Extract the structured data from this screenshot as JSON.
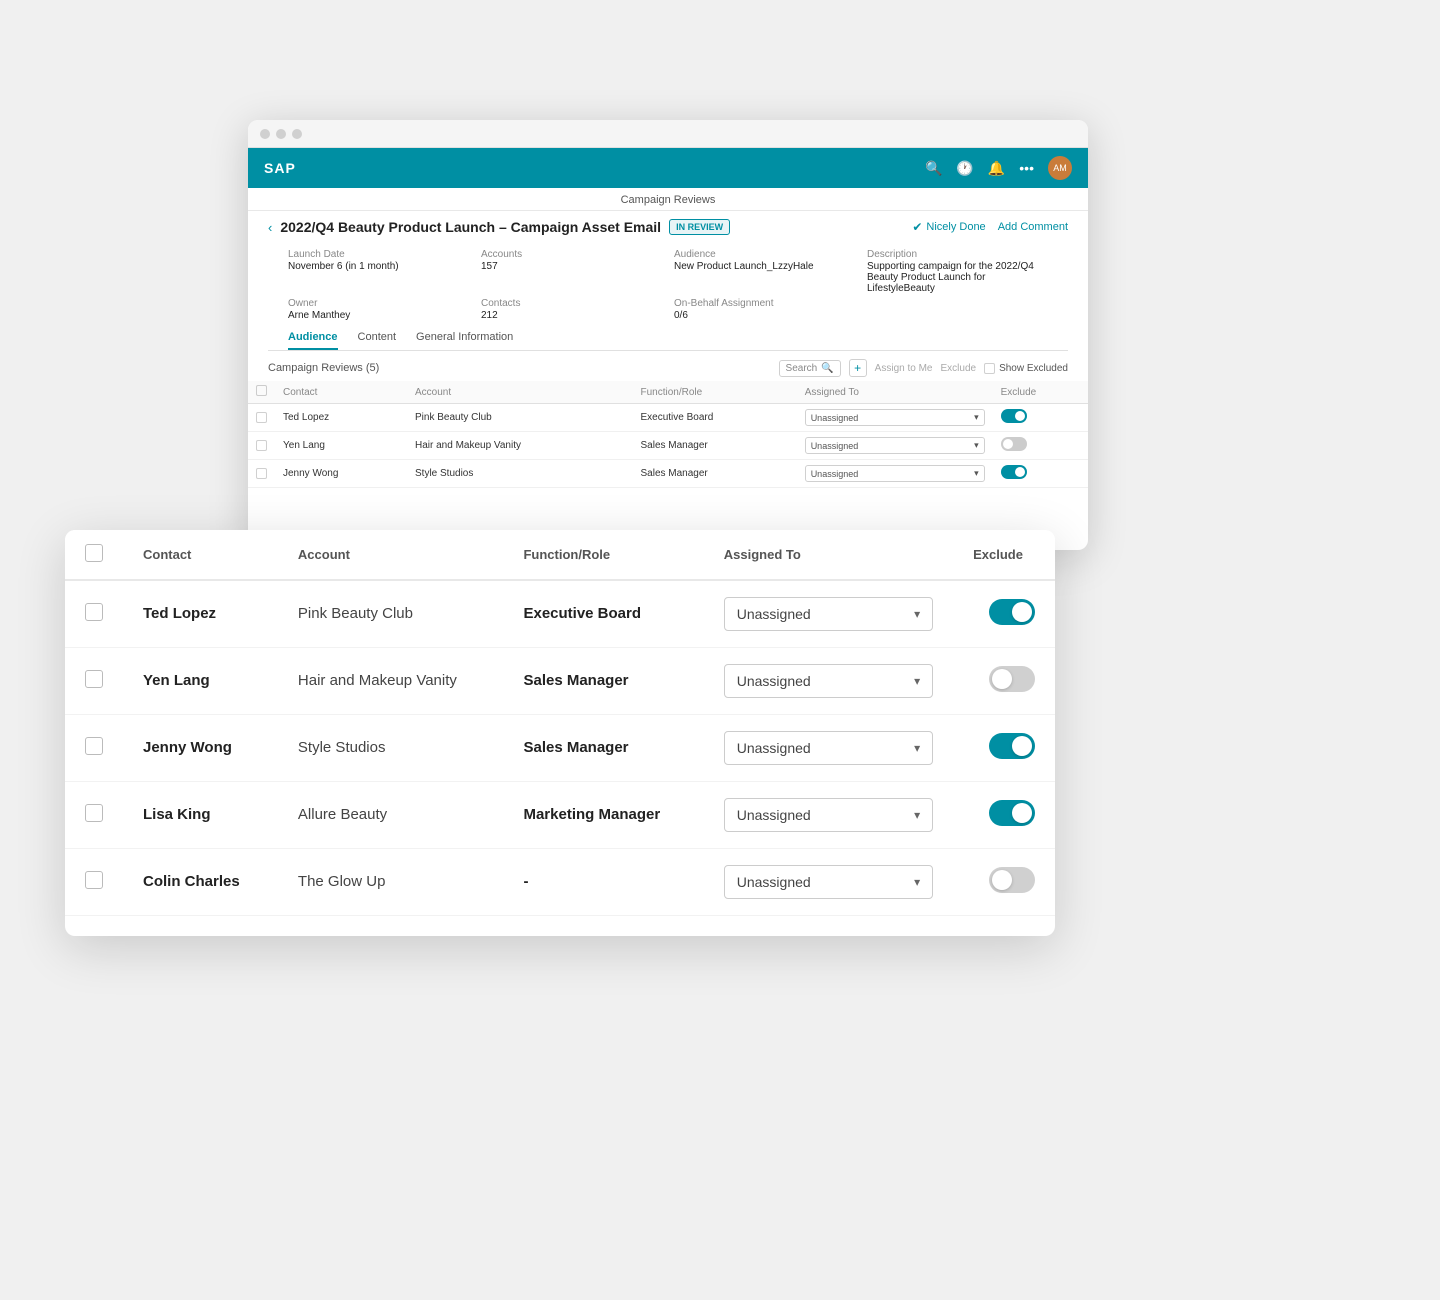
{
  "app": {
    "title": "Campaign Reviews"
  },
  "nav": {
    "logo": "SAP",
    "icons": [
      "search",
      "clock",
      "bell",
      "more"
    ],
    "avatar_initials": "AM"
  },
  "campaign": {
    "title": "2022/Q4 Beauty Product Launch – Campaign Asset Email",
    "status": "IN REVIEW",
    "nicely_done_label": "Nicely Done",
    "add_comment_label": "Add Comment",
    "meta": {
      "launch_date_label": "Launch Date",
      "launch_date_value": "November 6 (in 1 month)",
      "accounts_label": "Accounts",
      "accounts_value": "157",
      "audience_label": "Audience",
      "audience_value": "New Product Launch_LzzyHale",
      "description_label": "Description",
      "description_value": "Supporting campaign for the 2022/Q4 Beauty Product Launch for LifestyleBeauty",
      "owner_label": "Owner",
      "owner_value": "Arne Manthey",
      "contacts_label": "Contacts",
      "contacts_value": "212",
      "on_behalf_label": "On-Behalf Assignment",
      "on_behalf_value": "0/6"
    }
  },
  "tabs": [
    {
      "id": "audience",
      "label": "Audience",
      "active": true
    },
    {
      "id": "content",
      "label": "Content",
      "active": false
    },
    {
      "id": "general",
      "label": "General Information",
      "active": false
    }
  ],
  "table": {
    "title": "Campaign Reviews (5)",
    "search_placeholder": "Search",
    "add_label": "+",
    "assign_label": "Assign to Me",
    "exclude_label": "Exclude",
    "show_excluded_label": "Show Excluded",
    "columns": {
      "contact": "Contact",
      "account": "Account",
      "function_role": "Function/Role",
      "assigned_to": "Assigned To",
      "exclude": "Exclude"
    },
    "rows": [
      {
        "contact": "Ted Lopez",
        "account": "Pink Beauty Club",
        "role": "Executive Board",
        "assigned_to": "Unassigned",
        "exclude_on": true
      },
      {
        "contact": "Yen Lang",
        "account": "Hair and Makeup Vanity",
        "role": "Sales Manager",
        "assigned_to": "Unassigned",
        "exclude_on": false
      },
      {
        "contact": "Jenny Wong",
        "account": "Style Studios",
        "role": "Sales Manager",
        "assigned_to": "Unassigned",
        "exclude_on": true
      },
      {
        "contact": "Lisa King",
        "account": "Allure Beauty",
        "role": "Marketing Manager",
        "assigned_to": "Unassigned",
        "exclude_on": true
      },
      {
        "contact": "Colin Charles",
        "account": "The Glow Up",
        "role": "-",
        "assigned_to": "Unassigned",
        "exclude_on": false
      }
    ]
  }
}
